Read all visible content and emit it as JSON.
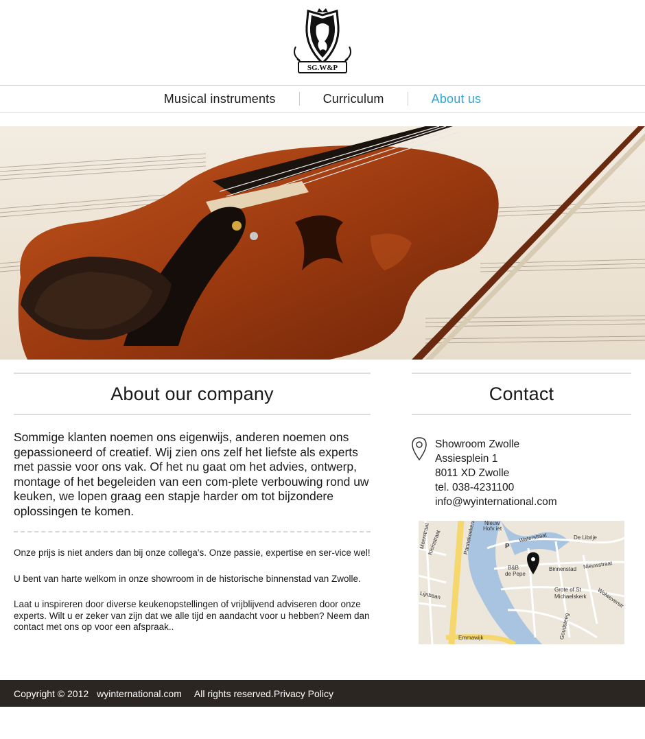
{
  "logo": {
    "icon": "lion-crest-icon",
    "text": "SG.W&P"
  },
  "nav": {
    "items": [
      {
        "label": "Musical instruments",
        "active": false
      },
      {
        "label": "Curriculum",
        "active": false
      },
      {
        "label": "About us",
        "active": true
      }
    ]
  },
  "hero": {
    "image": "violin-on-sheet-music"
  },
  "about": {
    "title": "About our company",
    "lead": "Sommige klanten noemen ons eigenwijs, anderen noemen ons gepassioneerd of creatief. Wij zien ons zelf het liefste als experts met passie voor ons vak. Of het nu gaat om het advies, ontwerp, montage of het begeleiden van een com-plete verbouwing rond uw keuken, we lopen graag een stapje harder om tot bijzondere oplossingen te komen.",
    "paragraphs": [
      "Onze prijs is niet anders dan bij onze collega's. Onze passie, expertise en ser-vice wel!",
      "U bent van harte welkom in onze showroom in de historische binnenstad van Zwolle.",
      "Laat u inspireren door diverse keukenopstellingen of vrijblijvend adviseren door onze experts. Wilt u er zeker van zijn dat we alle tijd en aandacht voor u hebben? Neem dan contact met ons op voor een afspraak.."
    ]
  },
  "contact": {
    "title": "Contact",
    "icon": "location-pin-icon",
    "lines": [
      "Showroom Zwolle",
      "Assiesplein 1",
      "8011 XD Zwolle",
      "tel. 038-4231100",
      "info@wyinternational.com"
    ],
    "map": {
      "labels": [
        "Pannekoekendijk",
        "Waterstraat",
        "De Librije",
        "Nieuwstraat",
        "Binnenstad",
        "B&B",
        "de Pepe",
        "Grote of St",
        "Michaelskerk",
        "Wolweverstr",
        "Lijnbaan",
        "Emmawijk",
        "Goudsteeg",
        "Nieuw",
        "Hofv iet",
        "Meerstraat",
        "Kleinstraat",
        "P"
      ]
    }
  },
  "footer": {
    "copyright": "Copyright © 2012",
    "site": "wyinternational.com",
    "rights": "All rights reserved.",
    "privacy": "Privacy Policy"
  }
}
